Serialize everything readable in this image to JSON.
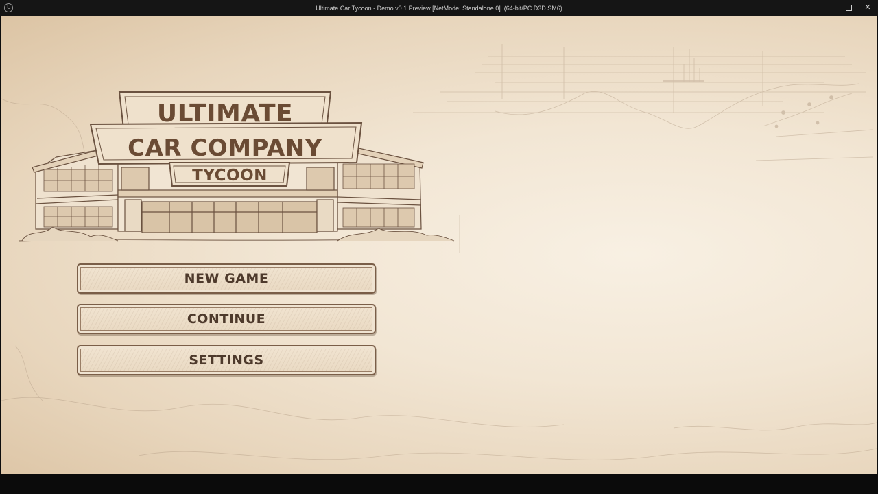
{
  "window": {
    "title": "Ultimate Car Tycoon - Demo v0.1 Preview [NetMode: Standalone 0]  (64-bit/PC D3D SM6)",
    "logo_glyph": "U",
    "minimize_icon": "minimize-icon",
    "maximize_icon": "maximize-icon",
    "close_glyph": "✕"
  },
  "logo": {
    "line1": "ULTIMATE",
    "line2": "CAR COMPANY",
    "line3": "TYCOON"
  },
  "menu": {
    "new_game": "NEW GAME",
    "continue": "CONTINUE",
    "settings": "SETTINGS"
  },
  "colors": {
    "parchment": "#f2e6d4",
    "ink": "#4e3a2c",
    "titlebar": "#151515"
  }
}
